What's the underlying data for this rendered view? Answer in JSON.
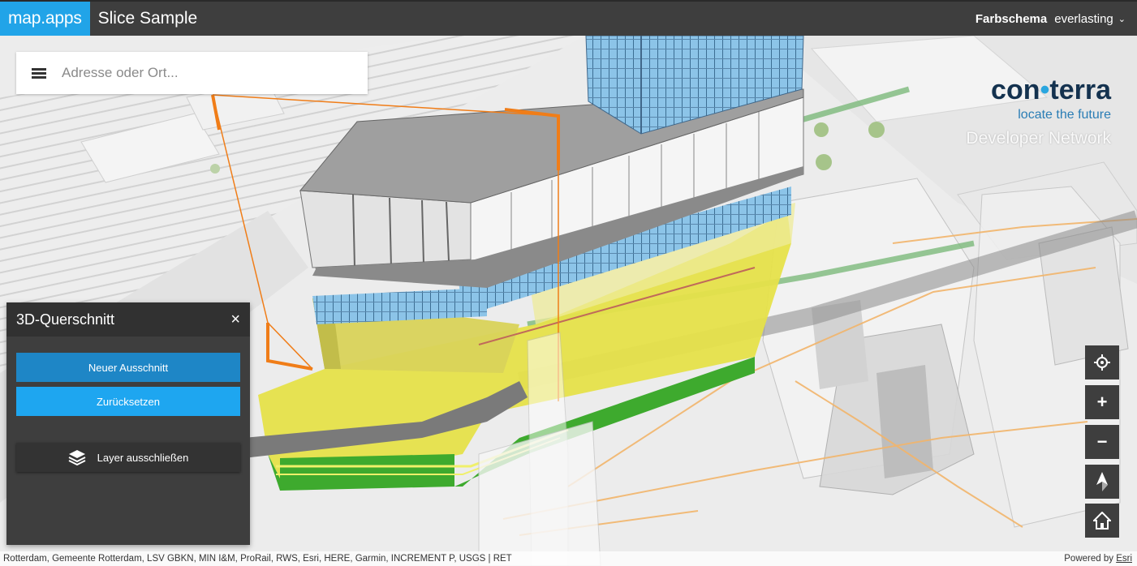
{
  "header": {
    "brand": "map.apps",
    "title": "Slice Sample",
    "scheme_label": "Farbschema",
    "scheme_value": "everlasting"
  },
  "search": {
    "placeholder": "Adresse oder Ort..."
  },
  "logo": {
    "name_left": "con",
    "name_right": "terra",
    "tagline": "locate the future",
    "network": "Developer Network"
  },
  "panel": {
    "title": "3D-Querschnitt",
    "close_glyph": "×",
    "new_label": "Neuer Ausschnitt",
    "reset_label": "Zurücksetzen",
    "exclude_label": "Layer ausschließen"
  },
  "controls": {
    "locate": "locate-icon",
    "zoom_in": "+",
    "zoom_out": "−",
    "compass": "compass-icon",
    "home": "home-icon"
  },
  "attribution": {
    "text": "Rotterdam, Gemeente Rotterdam, LSV GBKN, MIN I&M, ProRail, RWS, Esri, HERE, Garmin, INCREMENT P, USGS | RET",
    "powered_prefix": "Powered by ",
    "powered_link": "Esri"
  },
  "colors": {
    "brand": "#21a4e8",
    "header_bg": "#3e3e3e",
    "new_button": "#1e86c6",
    "reset_button": "#1ea6f0",
    "slice_line": "#f07d18"
  }
}
